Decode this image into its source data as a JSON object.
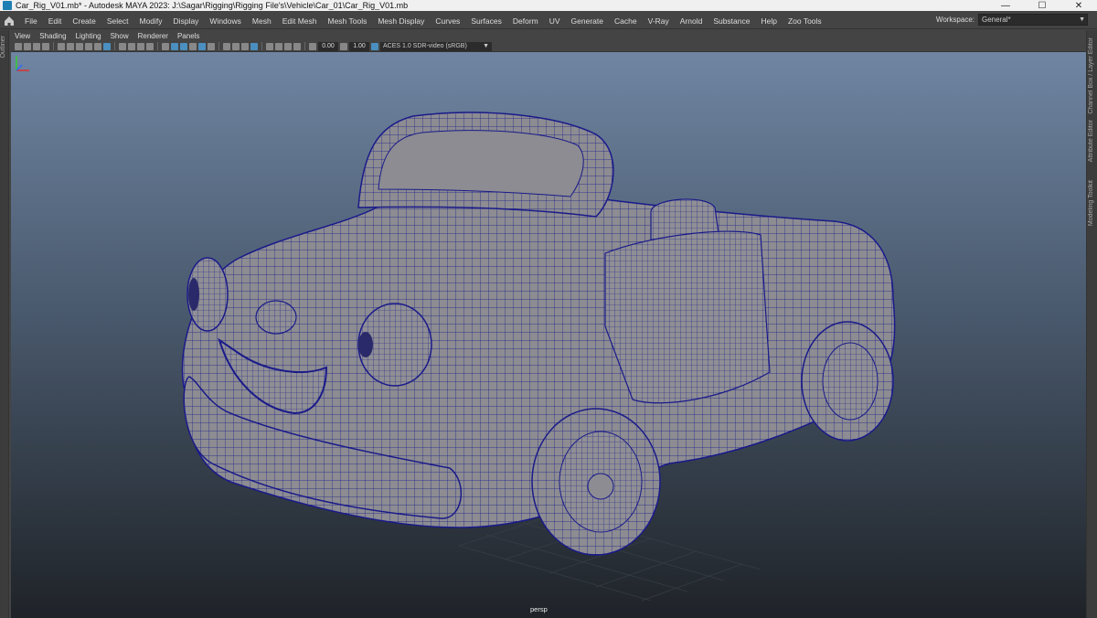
{
  "window": {
    "title": "Car_Rig_V01.mb* - Autodesk MAYA 2023: J:\\Sagar\\Rigging\\Rigging File's\\Vehicle\\Car_01\\Car_Rig_V01.mb",
    "minimize": "—",
    "maximize": "☐",
    "close": "✕"
  },
  "menubar": {
    "items": [
      "File",
      "Edit",
      "Create",
      "Select",
      "Modify",
      "Display",
      "Windows",
      "Mesh",
      "Edit Mesh",
      "Mesh Tools",
      "Mesh Display",
      "Curves",
      "Surfaces",
      "Deform",
      "UV",
      "Generate",
      "Cache",
      "V-Ray",
      "Arnold",
      "Substance",
      "Help",
      "Zoo Tools"
    ],
    "workspace_label": "Workspace:",
    "workspace_value": "General*"
  },
  "panel_menu": {
    "items": [
      "View",
      "Shading",
      "Lighting",
      "Show",
      "Renderer",
      "Panels"
    ]
  },
  "toolbar": {
    "exposure": "0.00",
    "gamma": "1.00",
    "color_space": "ACES 1.0 SDR-video (sRGB)"
  },
  "side_tabs": {
    "left": "Outliner",
    "right": [
      "Channel Box / Layer Editor",
      "Attribute Editor",
      "Modeling Toolkit"
    ]
  },
  "viewport": {
    "camera": "persp",
    "wire_color": "#1a1a8a",
    "mesh_color": "#8c8c92"
  },
  "icons": {
    "home": "home-icon",
    "app": "maya-app-icon"
  }
}
